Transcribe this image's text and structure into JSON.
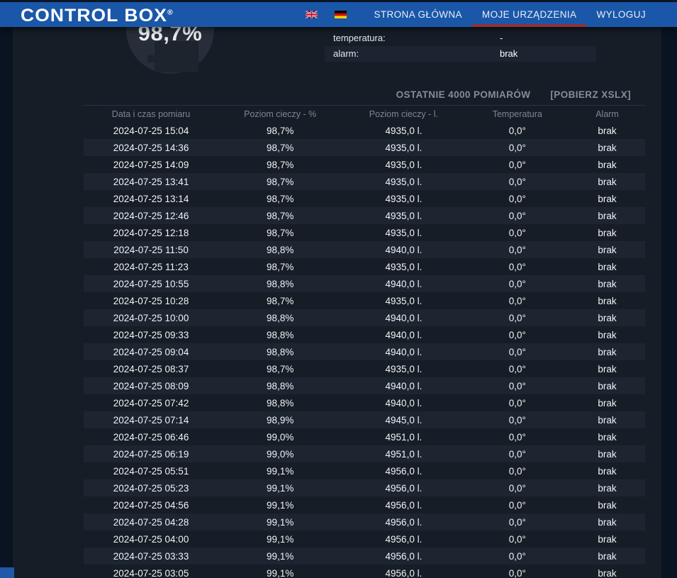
{
  "header": {
    "logo_text": "CONTROL BOX",
    "logo_registered": "®",
    "nav_items": [
      {
        "label": "STRONA GŁÓWNA",
        "active": false
      },
      {
        "label": "MOJE URZĄDZENIA",
        "active": true
      },
      {
        "label": "WYLOGUJ",
        "active": false
      }
    ],
    "flags": [
      "flag-uk",
      "flag-germany"
    ]
  },
  "device_panel": {
    "gauge_value": "98,7%",
    "info_rows": [
      {
        "label": "temperatura:",
        "value": "-"
      },
      {
        "label": "alarm:",
        "value": "brak"
      }
    ]
  },
  "measurements": {
    "section_title": "OSTATNIE 4000 POMIARÓW",
    "download_link": "[POBIERZ XSLX]",
    "columns": [
      "Data i czas pomiaru",
      "Poziom cieczy - %",
      "Poziom cieczy - l.",
      "Temperatura",
      "Alarm"
    ],
    "rows": [
      {
        "datetime": "2024-07-25 15:04",
        "percent": "98,7%",
        "liters": "4935,0 l.",
        "temperature": "0,0°",
        "alarm": "brak"
      },
      {
        "datetime": "2024-07-25 14:36",
        "percent": "98,7%",
        "liters": "4935,0 l.",
        "temperature": "0,0°",
        "alarm": "brak"
      },
      {
        "datetime": "2024-07-25 14:09",
        "percent": "98,7%",
        "liters": "4935,0 l.",
        "temperature": "0,0°",
        "alarm": "brak"
      },
      {
        "datetime": "2024-07-25 13:41",
        "percent": "98,7%",
        "liters": "4935,0 l.",
        "temperature": "0,0°",
        "alarm": "brak"
      },
      {
        "datetime": "2024-07-25 13:14",
        "percent": "98,7%",
        "liters": "4935,0 l.",
        "temperature": "0,0°",
        "alarm": "brak"
      },
      {
        "datetime": "2024-07-25 12:46",
        "percent": "98,7%",
        "liters": "4935,0 l.",
        "temperature": "0,0°",
        "alarm": "brak"
      },
      {
        "datetime": "2024-07-25 12:18",
        "percent": "98,7%",
        "liters": "4935,0 l.",
        "temperature": "0,0°",
        "alarm": "brak"
      },
      {
        "datetime": "2024-07-25 11:50",
        "percent": "98,8%",
        "liters": "4940,0 l.",
        "temperature": "0,0°",
        "alarm": "brak"
      },
      {
        "datetime": "2024-07-25 11:23",
        "percent": "98,7%",
        "liters": "4935,0 l.",
        "temperature": "0,0°",
        "alarm": "brak"
      },
      {
        "datetime": "2024-07-25 10:55",
        "percent": "98,8%",
        "liters": "4940,0 l.",
        "temperature": "0,0°",
        "alarm": "brak"
      },
      {
        "datetime": "2024-07-25 10:28",
        "percent": "98,7%",
        "liters": "4935,0 l.",
        "temperature": "0,0°",
        "alarm": "brak"
      },
      {
        "datetime": "2024-07-25 10:00",
        "percent": "98,8%",
        "liters": "4940,0 l.",
        "temperature": "0,0°",
        "alarm": "brak"
      },
      {
        "datetime": "2024-07-25 09:33",
        "percent": "98,8%",
        "liters": "4940,0 l.",
        "temperature": "0,0°",
        "alarm": "brak"
      },
      {
        "datetime": "2024-07-25 09:04",
        "percent": "98,8%",
        "liters": "4940,0 l.",
        "temperature": "0,0°",
        "alarm": "brak"
      },
      {
        "datetime": "2024-07-25 08:37",
        "percent": "98,7%",
        "liters": "4935,0 l.",
        "temperature": "0,0°",
        "alarm": "brak"
      },
      {
        "datetime": "2024-07-25 08:09",
        "percent": "98,8%",
        "liters": "4940,0 l.",
        "temperature": "0,0°",
        "alarm": "brak"
      },
      {
        "datetime": "2024-07-25 07:42",
        "percent": "98,8%",
        "liters": "4940,0 l.",
        "temperature": "0,0°",
        "alarm": "brak"
      },
      {
        "datetime": "2024-07-25 07:14",
        "percent": "98,9%",
        "liters": "4945,0 l.",
        "temperature": "0,0°",
        "alarm": "brak"
      },
      {
        "datetime": "2024-07-25 06:46",
        "percent": "99,0%",
        "liters": "4951,0 l.",
        "temperature": "0,0°",
        "alarm": "brak"
      },
      {
        "datetime": "2024-07-25 06:19",
        "percent": "99,0%",
        "liters": "4951,0 l.",
        "temperature": "0,0°",
        "alarm": "brak"
      },
      {
        "datetime": "2024-07-25 05:51",
        "percent": "99,1%",
        "liters": "4956,0 l.",
        "temperature": "0,0°",
        "alarm": "brak"
      },
      {
        "datetime": "2024-07-25 05:23",
        "percent": "99,1%",
        "liters": "4956,0 l.",
        "temperature": "0,0°",
        "alarm": "brak"
      },
      {
        "datetime": "2024-07-25 04:56",
        "percent": "99,1%",
        "liters": "4956,0 l.",
        "temperature": "0,0°",
        "alarm": "brak"
      },
      {
        "datetime": "2024-07-25 04:28",
        "percent": "99,1%",
        "liters": "4956,0 l.",
        "temperature": "0,0°",
        "alarm": "brak"
      },
      {
        "datetime": "2024-07-25 04:00",
        "percent": "99,1%",
        "liters": "4956,0 l.",
        "temperature": "0,0°",
        "alarm": "brak"
      },
      {
        "datetime": "2024-07-25 03:33",
        "percent": "99,1%",
        "liters": "4956,0 l.",
        "temperature": "0,0°",
        "alarm": "brak"
      },
      {
        "datetime": "2024-07-25 03:05",
        "percent": "99,1%",
        "liters": "4956,0 l.",
        "temperature": "0,0°",
        "alarm": "brak"
      }
    ]
  },
  "colors": {
    "header_blue": "#1a57a8",
    "active_underline_red": "#8f3238",
    "page_background": "#0a1322",
    "panel_background": "#161d27",
    "row_stripe": "#1d2531"
  }
}
